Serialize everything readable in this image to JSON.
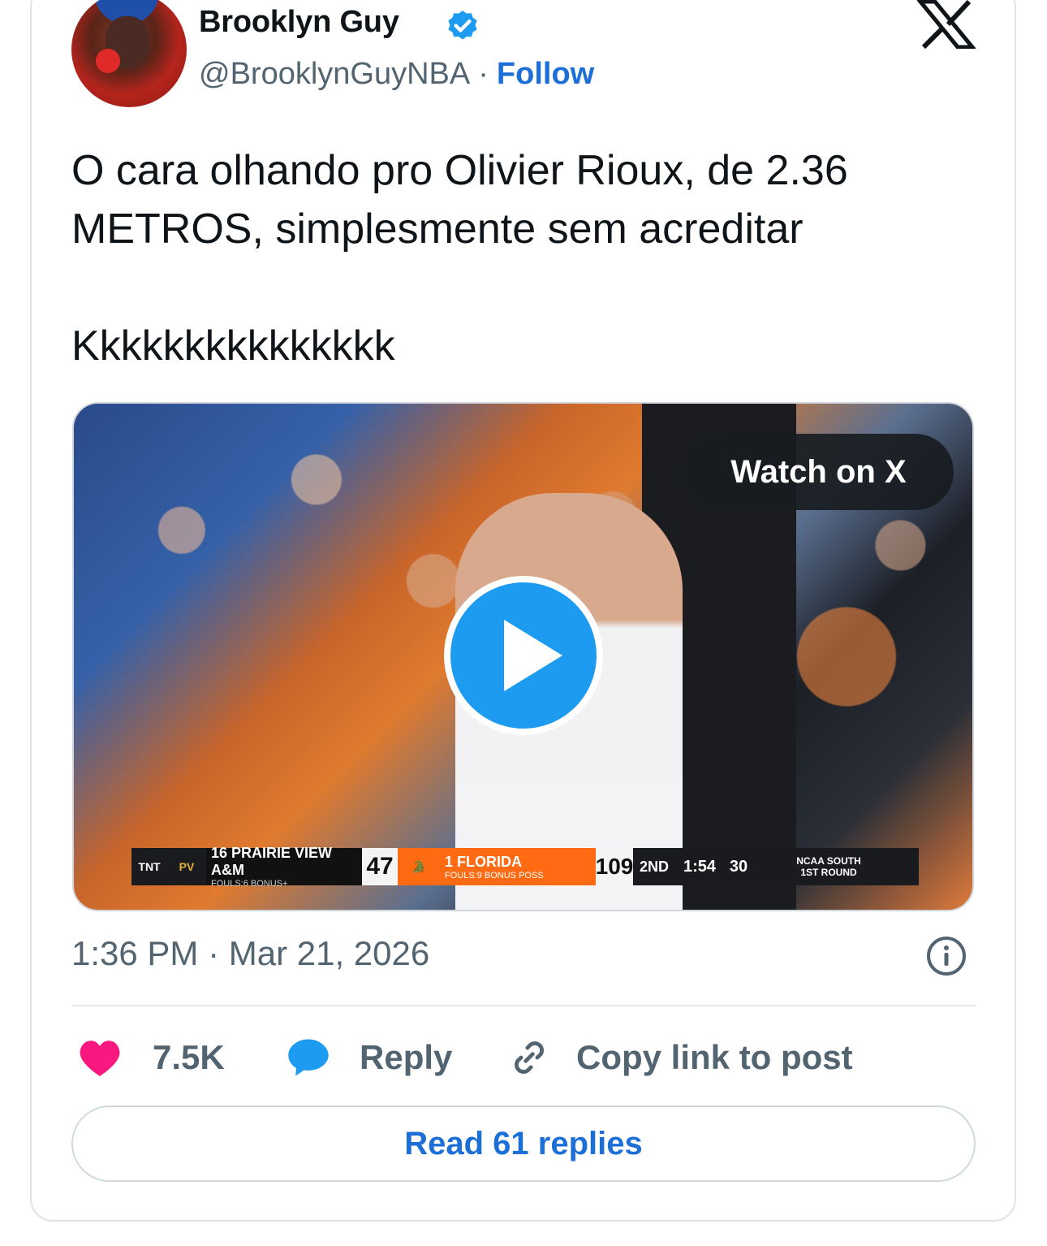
{
  "author": {
    "name": "Brooklyn Guy",
    "handle": "@BrooklynGuyNBA",
    "separator": "·",
    "follow_label": "Follow"
  },
  "tweet": {
    "text_line1": "O cara olhando pro Olivier Rioux, de 2.36 METROS, simplesmente sem acreditar",
    "text_line2": "Kkkkkkkkkkkkkkk"
  },
  "media": {
    "watch_label": "Watch on X",
    "scoreboard": {
      "network": "TNT",
      "team1_logo": "PV",
      "team1": "16 PRAIRIE VIEW A&M",
      "team1_sub": "FOULS:6    BONUS+",
      "team1_score": "47",
      "team2": "1 FLORIDA",
      "team2_sub": "FOULS:9    BONUS    POSS",
      "team2_score": "109",
      "period": "2ND",
      "clock": "1:54",
      "shot_clock": "30",
      "round_line1": "NCAA SOUTH",
      "round_line2": "1ST ROUND"
    }
  },
  "meta": {
    "timestamp": "1:36 PM · Mar 21, 2026"
  },
  "actions": {
    "likes": "7.5K",
    "reply_label": "Reply",
    "copy_label": "Copy link to post"
  },
  "read_replies_label": "Read 61 replies",
  "colors": {
    "accent": "#1d6fd8",
    "like": "#f91880",
    "reply_icon": "#1d9bf0",
    "muted": "#536471"
  },
  "icons": {
    "verified": "verified-badge-icon",
    "x_logo": "x-logo-icon",
    "info": "info-icon",
    "like": "heart-icon",
    "reply": "speech-bubble-icon",
    "copy": "link-icon",
    "play": "play-icon"
  }
}
